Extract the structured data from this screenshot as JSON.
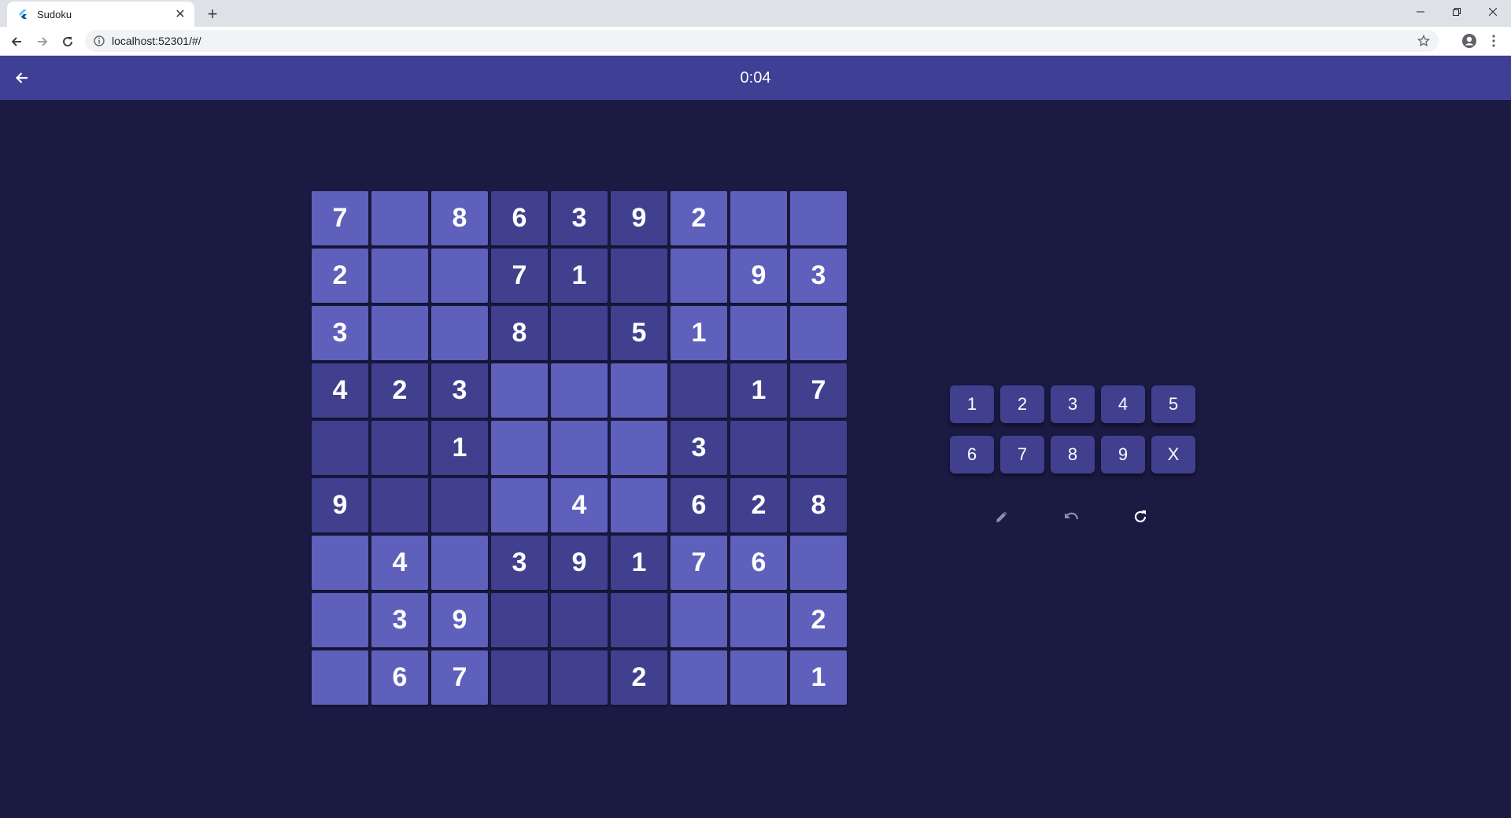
{
  "browser": {
    "tab_title": "Sudoku",
    "url": "localhost:52301/#/",
    "new_tab_label": "+"
  },
  "appbar": {
    "timer": "0:04"
  },
  "board": {
    "rows": [
      [
        "7",
        "",
        "8",
        "6",
        "3",
        "9",
        "2",
        "",
        ""
      ],
      [
        "2",
        "",
        "",
        "7",
        "1",
        "",
        "",
        "9",
        "3"
      ],
      [
        "3",
        "",
        "",
        "8",
        "",
        "5",
        "1",
        "",
        ""
      ],
      [
        "4",
        "2",
        "3",
        "",
        "",
        "",
        "",
        "1",
        "7"
      ],
      [
        "",
        "",
        "1",
        "",
        "",
        "",
        "3",
        "",
        ""
      ],
      [
        "9",
        "",
        "",
        "",
        "4",
        "",
        "6",
        "2",
        "8"
      ],
      [
        "",
        "4",
        "",
        "3",
        "9",
        "1",
        "7",
        "6",
        ""
      ],
      [
        "",
        "3",
        "9",
        "",
        "",
        "",
        "",
        "",
        "2"
      ],
      [
        "",
        "6",
        "7",
        "",
        "",
        "2",
        "",
        "",
        "1"
      ]
    ]
  },
  "numpad": {
    "keys": [
      "1",
      "2",
      "3",
      "4",
      "5",
      "6",
      "7",
      "8",
      "9",
      "X"
    ]
  },
  "tools": {
    "icons": [
      "pencil-icon",
      "undo-icon",
      "refresh-icon"
    ]
  },
  "colors": {
    "background": "#1a1a42",
    "appbar": "#3f3f95",
    "cell_light": "#5f5fbc",
    "cell_dark": "#40408f"
  }
}
